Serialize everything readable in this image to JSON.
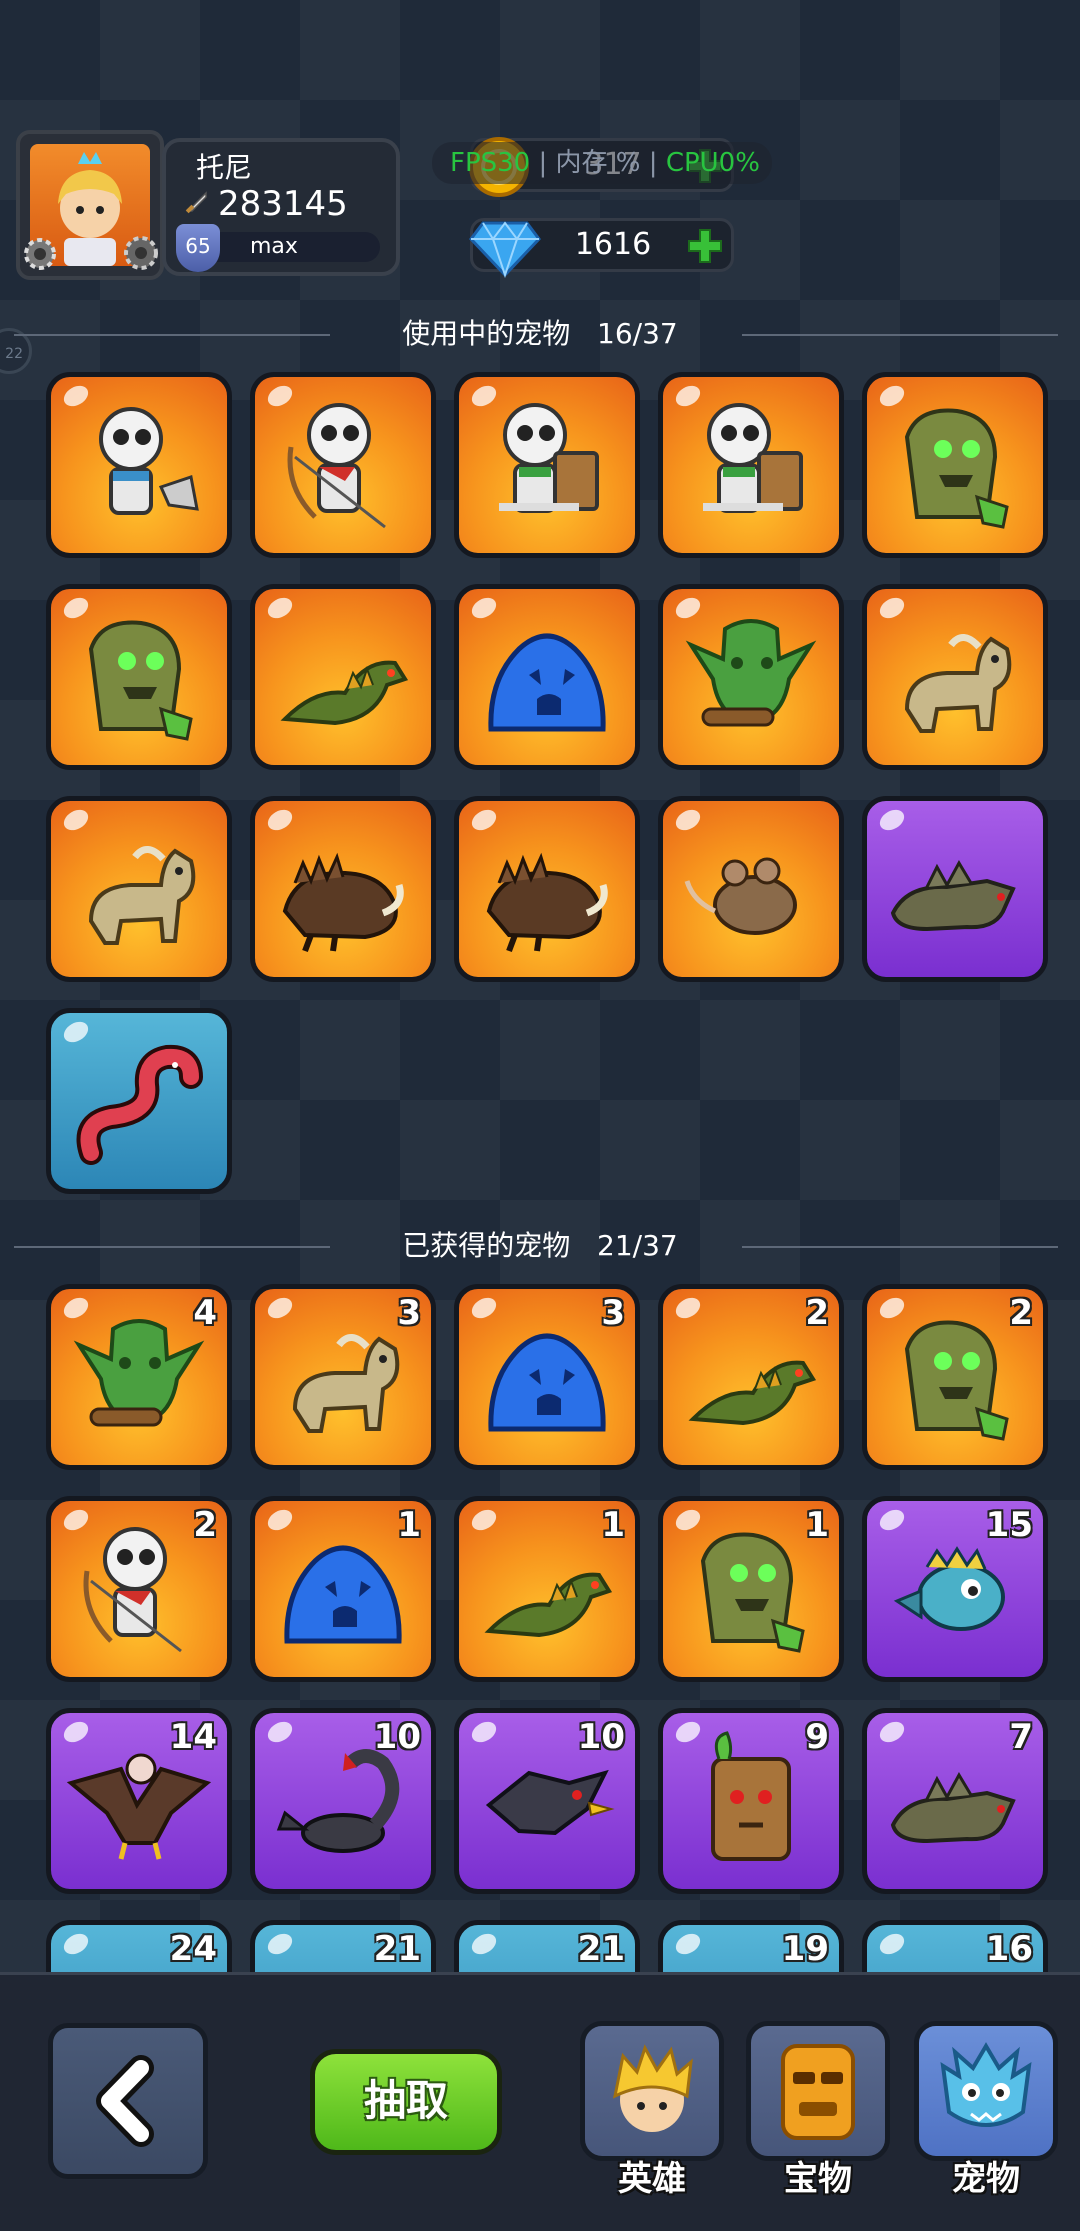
{
  "player": {
    "name": "托尼",
    "power": "283145",
    "level": "65",
    "level_label": "max"
  },
  "currency": {
    "coins": "317",
    "gems": "1616"
  },
  "debug_overlay": {
    "fps": "FPS30",
    "mem": "内存 %",
    "cpu": "CPU0%"
  },
  "side_badge": "22",
  "equipped_section": {
    "title": "使用中的宠物",
    "count": "16/37"
  },
  "owned_section": {
    "title": "已获得的宠物",
    "count": "21/37"
  },
  "equipped_pets": [
    {
      "pet": "skeleton-axe-icon",
      "rarity": "orange"
    },
    {
      "pet": "skeleton-archer-icon",
      "rarity": "orange"
    },
    {
      "pet": "skeleton-shield-icon",
      "rarity": "orange"
    },
    {
      "pet": "skeleton-shield-icon",
      "rarity": "orange"
    },
    {
      "pet": "zombie-icon",
      "rarity": "orange"
    },
    {
      "pet": "zombie-icon",
      "rarity": "orange"
    },
    {
      "pet": "lizard-icon",
      "rarity": "orange"
    },
    {
      "pet": "slime-icon",
      "rarity": "orange"
    },
    {
      "pet": "goblin-icon",
      "rarity": "orange"
    },
    {
      "pet": "goat-icon",
      "rarity": "orange"
    },
    {
      "pet": "goat-icon",
      "rarity": "orange"
    },
    {
      "pet": "boar-icon",
      "rarity": "orange"
    },
    {
      "pet": "boar-icon",
      "rarity": "orange"
    },
    {
      "pet": "rat-icon",
      "rarity": "orange"
    },
    {
      "pet": "wolf-icon",
      "rarity": "purple"
    },
    {
      "pet": "worm-icon",
      "rarity": "blue"
    }
  ],
  "owned_pets": [
    {
      "pet": "goblin-icon",
      "rarity": "orange",
      "count": "4"
    },
    {
      "pet": "goat-icon",
      "rarity": "orange",
      "count": "3"
    },
    {
      "pet": "slime-icon",
      "rarity": "orange",
      "count": "3"
    },
    {
      "pet": "lizard-icon",
      "rarity": "orange",
      "count": "2"
    },
    {
      "pet": "zombie-icon",
      "rarity": "orange",
      "count": "2"
    },
    {
      "pet": "skeleton-archer-icon",
      "rarity": "orange",
      "count": "2"
    },
    {
      "pet": "slime-icon",
      "rarity": "orange",
      "count": "1"
    },
    {
      "pet": "lizard-icon",
      "rarity": "orange",
      "count": "1"
    },
    {
      "pet": "zombie-icon",
      "rarity": "orange",
      "count": "1"
    },
    {
      "pet": "fish-icon",
      "rarity": "purple",
      "count": "15"
    },
    {
      "pet": "vulture-icon",
      "rarity": "purple",
      "count": "14"
    },
    {
      "pet": "scorpion-icon",
      "rarity": "purple",
      "count": "10"
    },
    {
      "pet": "crow-icon",
      "rarity": "purple",
      "count": "10"
    },
    {
      "pet": "treant-icon",
      "rarity": "purple",
      "count": "9"
    },
    {
      "pet": "wolf-icon",
      "rarity": "purple",
      "count": "7"
    }
  ],
  "owned_partial_row": [
    "24",
    "21",
    "21",
    "19",
    "16"
  ],
  "buttons": {
    "draw": "抽取"
  },
  "tabs": [
    {
      "label": "英雄",
      "icon": "hero-icon"
    },
    {
      "label": "宝物",
      "icon": "treasure-icon"
    },
    {
      "label": "宠物",
      "icon": "pet-tab-icon"
    }
  ],
  "colors": {
    "orange": "#f7941d",
    "purple": "#8b45dc",
    "blue": "#3c9cc8",
    "accent_green": "#5cc020"
  }
}
